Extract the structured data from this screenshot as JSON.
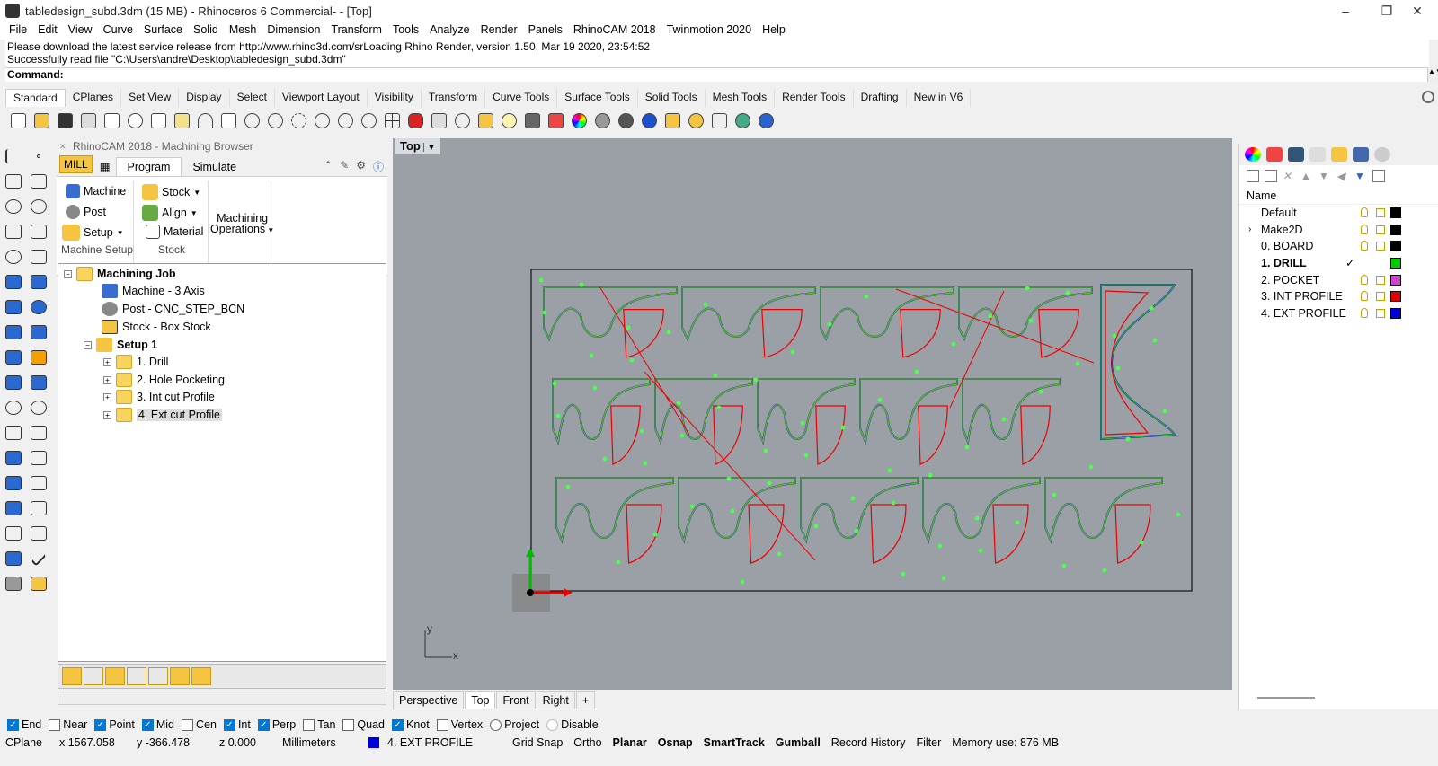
{
  "window": {
    "title": "tabledesign_subd.3dm (15 MB) - Rhinoceros 6 Commercial- - [Top]",
    "minimize": "–",
    "maximize": "❐",
    "close": "✕"
  },
  "menu": [
    "File",
    "Edit",
    "View",
    "Curve",
    "Surface",
    "Solid",
    "Mesh",
    "Dimension",
    "Transform",
    "Tools",
    "Analyze",
    "Render",
    "Panels",
    "RhinoCAM 2018",
    "Twinmotion 2020",
    "Help"
  ],
  "command": {
    "line1": "Please download the latest service release from http://www.rhino3d.com/srLoading Rhino Render, version 1.50, Mar 19 2020, 23:54:52",
    "line2": "Successfully read file \"C:\\Users\\andre\\Desktop\\tabledesign_subd.3dm\"",
    "prompt": "Command:"
  },
  "toolbar_tabs": [
    "Standard",
    "CPlanes",
    "Set View",
    "Display",
    "Select",
    "Viewport Layout",
    "Visibility",
    "Transform",
    "Curve Tools",
    "Surface Tools",
    "Solid Tools",
    "Mesh Tools",
    "Render Tools",
    "Drafting",
    "New in V6"
  ],
  "browser": {
    "title": "RhinoCAM 2018 - Machining Browser",
    "mill": "MILL",
    "tabs": [
      "Program",
      "Simulate"
    ],
    "ribbon": {
      "machine": "Machine",
      "post": "Post",
      "setup": "Setup",
      "stock": "Stock",
      "align": "Align",
      "material": "Material",
      "mops_line1": "Machining",
      "mops_line2": "Operations",
      "group1": "Machine Setup",
      "group2": "Stock"
    },
    "tree": {
      "job": "Machining Job",
      "machine": "Machine - 3 Axis",
      "post": "Post - CNC_STEP_BCN",
      "stock": "Stock - Box Stock",
      "setup": "Setup 1",
      "ops": [
        "1. Drill",
        "2. Hole Pocketing",
        "3. Int cut Profile",
        "4. Ext cut Profile"
      ]
    }
  },
  "viewport": {
    "label": "Top",
    "axis_y": "y",
    "axis_x": "x"
  },
  "view_tabs": [
    "Perspective",
    "Top",
    "Front",
    "Right"
  ],
  "layers": {
    "header": "Name",
    "rows": [
      {
        "name": "Default",
        "color": "#000000"
      },
      {
        "name": "Make2D",
        "color": "#000000"
      },
      {
        "name": "0. BOARD",
        "color": "#000000"
      },
      {
        "name": "1. DRILL",
        "color": "#00cc00"
      },
      {
        "name": "2. POCKET",
        "color": "#cc44cc"
      },
      {
        "name": "3. INT PROFILE",
        "color": "#e00000"
      },
      {
        "name": "4. EXT PROFILE",
        "color": "#0000dd"
      }
    ],
    "current_mark": "✓"
  },
  "osnaps": [
    {
      "label": "End",
      "on": true
    },
    {
      "label": "Near",
      "on": false
    },
    {
      "label": "Point",
      "on": true
    },
    {
      "label": "Mid",
      "on": true
    },
    {
      "label": "Cen",
      "on": false
    },
    {
      "label": "Int",
      "on": true
    },
    {
      "label": "Perp",
      "on": true
    },
    {
      "label": "Tan",
      "on": false
    },
    {
      "label": "Quad",
      "on": false
    },
    {
      "label": "Knot",
      "on": true
    },
    {
      "label": "Vertex",
      "on": false
    },
    {
      "label": "Project",
      "on": false
    },
    {
      "label": "Disable",
      "on": false
    }
  ],
  "status": {
    "cplane": "CPlane",
    "x": "x 1567.058",
    "y": "y -366.478",
    "z": "z 0.000",
    "units": "Millimeters",
    "layer": "4. EXT PROFILE",
    "grid": "Grid Snap",
    "ortho": "Ortho",
    "planar": "Planar",
    "osnap": "Osnap",
    "smarttrack": "SmartTrack",
    "gumball": "Gumball",
    "history": "Record History",
    "filter": "Filter",
    "memory": "Memory use: 876 MB"
  }
}
